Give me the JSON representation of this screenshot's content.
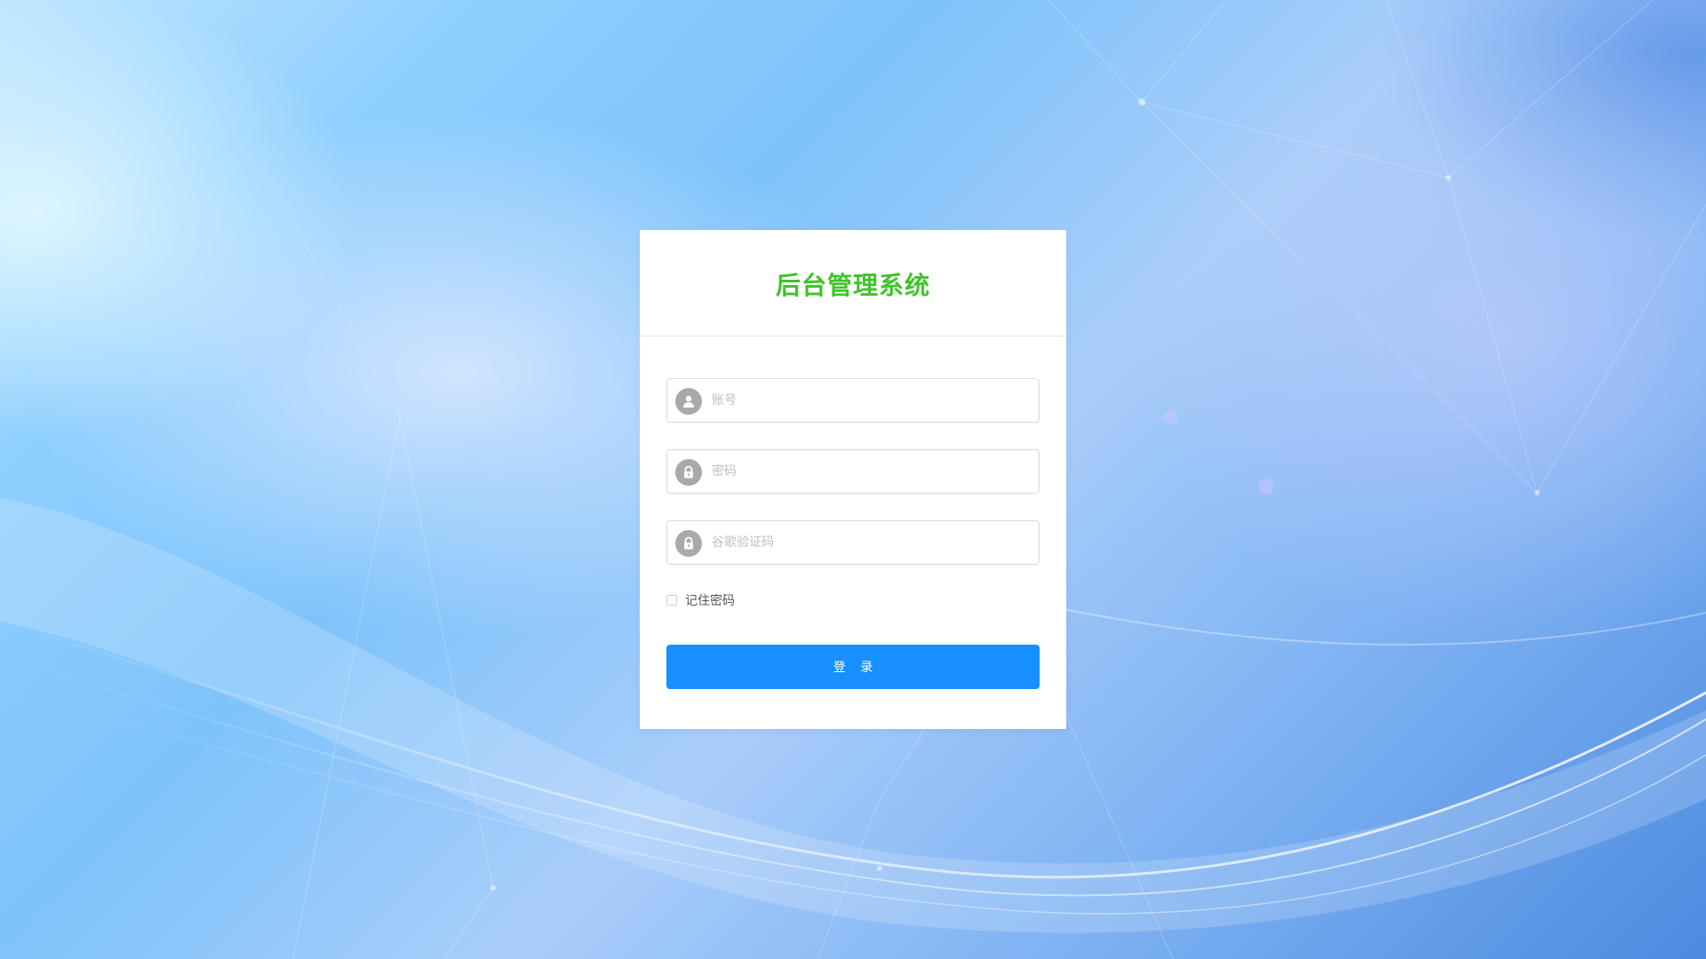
{
  "login": {
    "title": "后台管理系统",
    "title_color": "#3fc42a",
    "fields": {
      "account": {
        "icon": "user-icon",
        "value": "",
        "placeholder": "账号"
      },
      "password": {
        "icon": "lock-icon",
        "value": "",
        "placeholder": "密码"
      },
      "google_code": {
        "icon": "lock-icon",
        "value": "",
        "placeholder": "谷歌验证码"
      }
    },
    "remember": {
      "label": "记住密码",
      "checked": false
    },
    "submit_label": "登 录",
    "button_color": "#1890ff"
  }
}
